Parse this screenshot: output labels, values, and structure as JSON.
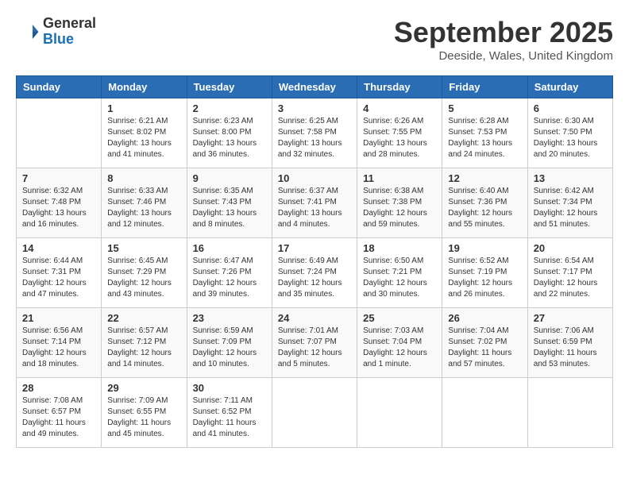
{
  "header": {
    "logo_general": "General",
    "logo_blue": "Blue",
    "month_title": "September 2025",
    "location": "Deeside, Wales, United Kingdom"
  },
  "weekdays": [
    "Sunday",
    "Monday",
    "Tuesday",
    "Wednesday",
    "Thursday",
    "Friday",
    "Saturday"
  ],
  "weeks": [
    [
      {
        "day": "",
        "sunrise": "",
        "sunset": "",
        "daylight": ""
      },
      {
        "day": "1",
        "sunrise": "Sunrise: 6:21 AM",
        "sunset": "Sunset: 8:02 PM",
        "daylight": "Daylight: 13 hours and 41 minutes."
      },
      {
        "day": "2",
        "sunrise": "Sunrise: 6:23 AM",
        "sunset": "Sunset: 8:00 PM",
        "daylight": "Daylight: 13 hours and 36 minutes."
      },
      {
        "day": "3",
        "sunrise": "Sunrise: 6:25 AM",
        "sunset": "Sunset: 7:58 PM",
        "daylight": "Daylight: 13 hours and 32 minutes."
      },
      {
        "day": "4",
        "sunrise": "Sunrise: 6:26 AM",
        "sunset": "Sunset: 7:55 PM",
        "daylight": "Daylight: 13 hours and 28 minutes."
      },
      {
        "day": "5",
        "sunrise": "Sunrise: 6:28 AM",
        "sunset": "Sunset: 7:53 PM",
        "daylight": "Daylight: 13 hours and 24 minutes."
      },
      {
        "day": "6",
        "sunrise": "Sunrise: 6:30 AM",
        "sunset": "Sunset: 7:50 PM",
        "daylight": "Daylight: 13 hours and 20 minutes."
      }
    ],
    [
      {
        "day": "7",
        "sunrise": "Sunrise: 6:32 AM",
        "sunset": "Sunset: 7:48 PM",
        "daylight": "Daylight: 13 hours and 16 minutes."
      },
      {
        "day": "8",
        "sunrise": "Sunrise: 6:33 AM",
        "sunset": "Sunset: 7:46 PM",
        "daylight": "Daylight: 13 hours and 12 minutes."
      },
      {
        "day": "9",
        "sunrise": "Sunrise: 6:35 AM",
        "sunset": "Sunset: 7:43 PM",
        "daylight": "Daylight: 13 hours and 8 minutes."
      },
      {
        "day": "10",
        "sunrise": "Sunrise: 6:37 AM",
        "sunset": "Sunset: 7:41 PM",
        "daylight": "Daylight: 13 hours and 4 minutes."
      },
      {
        "day": "11",
        "sunrise": "Sunrise: 6:38 AM",
        "sunset": "Sunset: 7:38 PM",
        "daylight": "Daylight: 12 hours and 59 minutes."
      },
      {
        "day": "12",
        "sunrise": "Sunrise: 6:40 AM",
        "sunset": "Sunset: 7:36 PM",
        "daylight": "Daylight: 12 hours and 55 minutes."
      },
      {
        "day": "13",
        "sunrise": "Sunrise: 6:42 AM",
        "sunset": "Sunset: 7:34 PM",
        "daylight": "Daylight: 12 hours and 51 minutes."
      }
    ],
    [
      {
        "day": "14",
        "sunrise": "Sunrise: 6:44 AM",
        "sunset": "Sunset: 7:31 PM",
        "daylight": "Daylight: 12 hours and 47 minutes."
      },
      {
        "day": "15",
        "sunrise": "Sunrise: 6:45 AM",
        "sunset": "Sunset: 7:29 PM",
        "daylight": "Daylight: 12 hours and 43 minutes."
      },
      {
        "day": "16",
        "sunrise": "Sunrise: 6:47 AM",
        "sunset": "Sunset: 7:26 PM",
        "daylight": "Daylight: 12 hours and 39 minutes."
      },
      {
        "day": "17",
        "sunrise": "Sunrise: 6:49 AM",
        "sunset": "Sunset: 7:24 PM",
        "daylight": "Daylight: 12 hours and 35 minutes."
      },
      {
        "day": "18",
        "sunrise": "Sunrise: 6:50 AM",
        "sunset": "Sunset: 7:21 PM",
        "daylight": "Daylight: 12 hours and 30 minutes."
      },
      {
        "day": "19",
        "sunrise": "Sunrise: 6:52 AM",
        "sunset": "Sunset: 7:19 PM",
        "daylight": "Daylight: 12 hours and 26 minutes."
      },
      {
        "day": "20",
        "sunrise": "Sunrise: 6:54 AM",
        "sunset": "Sunset: 7:17 PM",
        "daylight": "Daylight: 12 hours and 22 minutes."
      }
    ],
    [
      {
        "day": "21",
        "sunrise": "Sunrise: 6:56 AM",
        "sunset": "Sunset: 7:14 PM",
        "daylight": "Daylight: 12 hours and 18 minutes."
      },
      {
        "day": "22",
        "sunrise": "Sunrise: 6:57 AM",
        "sunset": "Sunset: 7:12 PM",
        "daylight": "Daylight: 12 hours and 14 minutes."
      },
      {
        "day": "23",
        "sunrise": "Sunrise: 6:59 AM",
        "sunset": "Sunset: 7:09 PM",
        "daylight": "Daylight: 12 hours and 10 minutes."
      },
      {
        "day": "24",
        "sunrise": "Sunrise: 7:01 AM",
        "sunset": "Sunset: 7:07 PM",
        "daylight": "Daylight: 12 hours and 5 minutes."
      },
      {
        "day": "25",
        "sunrise": "Sunrise: 7:03 AM",
        "sunset": "Sunset: 7:04 PM",
        "daylight": "Daylight: 12 hours and 1 minute."
      },
      {
        "day": "26",
        "sunrise": "Sunrise: 7:04 AM",
        "sunset": "Sunset: 7:02 PM",
        "daylight": "Daylight: 11 hours and 57 minutes."
      },
      {
        "day": "27",
        "sunrise": "Sunrise: 7:06 AM",
        "sunset": "Sunset: 6:59 PM",
        "daylight": "Daylight: 11 hours and 53 minutes."
      }
    ],
    [
      {
        "day": "28",
        "sunrise": "Sunrise: 7:08 AM",
        "sunset": "Sunset: 6:57 PM",
        "daylight": "Daylight: 11 hours and 49 minutes."
      },
      {
        "day": "29",
        "sunrise": "Sunrise: 7:09 AM",
        "sunset": "Sunset: 6:55 PM",
        "daylight": "Daylight: 11 hours and 45 minutes."
      },
      {
        "day": "30",
        "sunrise": "Sunrise: 7:11 AM",
        "sunset": "Sunset: 6:52 PM",
        "daylight": "Daylight: 11 hours and 41 minutes."
      },
      {
        "day": "",
        "sunrise": "",
        "sunset": "",
        "daylight": ""
      },
      {
        "day": "",
        "sunrise": "",
        "sunset": "",
        "daylight": ""
      },
      {
        "day": "",
        "sunrise": "",
        "sunset": "",
        "daylight": ""
      },
      {
        "day": "",
        "sunrise": "",
        "sunset": "",
        "daylight": ""
      }
    ]
  ]
}
